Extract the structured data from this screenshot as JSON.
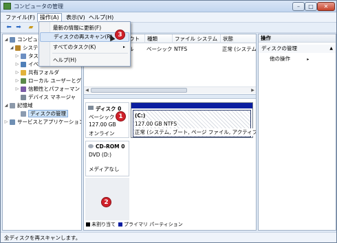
{
  "window": {
    "title": "コンピュータの管理",
    "controls": {
      "minimize": "–",
      "maximize": "□",
      "close": "✕"
    }
  },
  "menubar": {
    "items": [
      {
        "label": "ファイル(F)"
      },
      {
        "label": "操作(A)",
        "active": true
      },
      {
        "label": "表示(V)"
      },
      {
        "label": "ヘルプ(H)"
      }
    ]
  },
  "toolbar": {
    "icons": [
      "back-arrow-icon",
      "forward-arrow-icon",
      "up-folder-icon"
    ]
  },
  "action_menu": {
    "items": [
      {
        "label": "最新の情報に更新(F)"
      },
      {
        "label": "ディスクの再スキャン(R)",
        "highlighted": true
      },
      {
        "label": "すべてのタスク(K)",
        "submenu_arrow": "▸"
      },
      {
        "label": "ヘルプ(H)"
      }
    ]
  },
  "tree": {
    "items": [
      {
        "label": "コンピュー",
        "level": 0,
        "arrow": "◢"
      },
      {
        "label": "システ",
        "level": 1,
        "arrow": "◢"
      },
      {
        "label": "タス",
        "level": 2,
        "arrow": "▷"
      },
      {
        "label": "イベ",
        "level": 2,
        "arrow": "▷"
      },
      {
        "label": "共有フォルダ",
        "level": 2,
        "arrow": "▷"
      },
      {
        "label": "ローカル ユーザーとグ",
        "level": 2,
        "arrow": "▷"
      },
      {
        "label": "信頼性とパフォーマン",
        "level": 2,
        "arrow": "▷"
      },
      {
        "label": "デバイス マネージャ",
        "level": 2,
        "arrow": ""
      },
      {
        "label": "記憶域",
        "level": 1,
        "arrow": "◢"
      },
      {
        "label": "ディスクの管理",
        "level": 2,
        "arrow": "",
        "selected": true
      },
      {
        "label": "サービスとアプリケーション",
        "level": 1,
        "arrow": "▷"
      }
    ]
  },
  "volume_list": {
    "columns": [
      "ウト",
      "種類",
      "ファイル システム",
      "状態"
    ],
    "row": [
      "ル",
      "ベーシック",
      "NTFS",
      "正常 (システム"
    ]
  },
  "disks": {
    "disk0": {
      "name": "ディスク 0",
      "type": "ベーシック",
      "size": "127.00 GB",
      "status": "オンライン",
      "partition": {
        "name": "(C:)",
        "size": "127.00 GB NTFS",
        "status": "正常 (システム, ブート, ページ ファイル, アクティブ,"
      }
    },
    "cdrom0": {
      "name": "CD-ROM 0",
      "drive": "DVD (D:)",
      "media": "メディアなし"
    }
  },
  "legend": [
    {
      "label": "未割り当て",
      "color": "#000000"
    },
    {
      "label": "プライマリ パーティション",
      "color": "#0b1ea0"
    }
  ],
  "actions": {
    "header": "操作",
    "section": "ディスクの管理",
    "section_chevron": "▲",
    "other_label": "他の操作",
    "other_chevron": "▸"
  },
  "status": {
    "text": "全ディスクを再スキャンします。"
  },
  "badges": {
    "one": "1",
    "two": "2",
    "three": "3"
  }
}
